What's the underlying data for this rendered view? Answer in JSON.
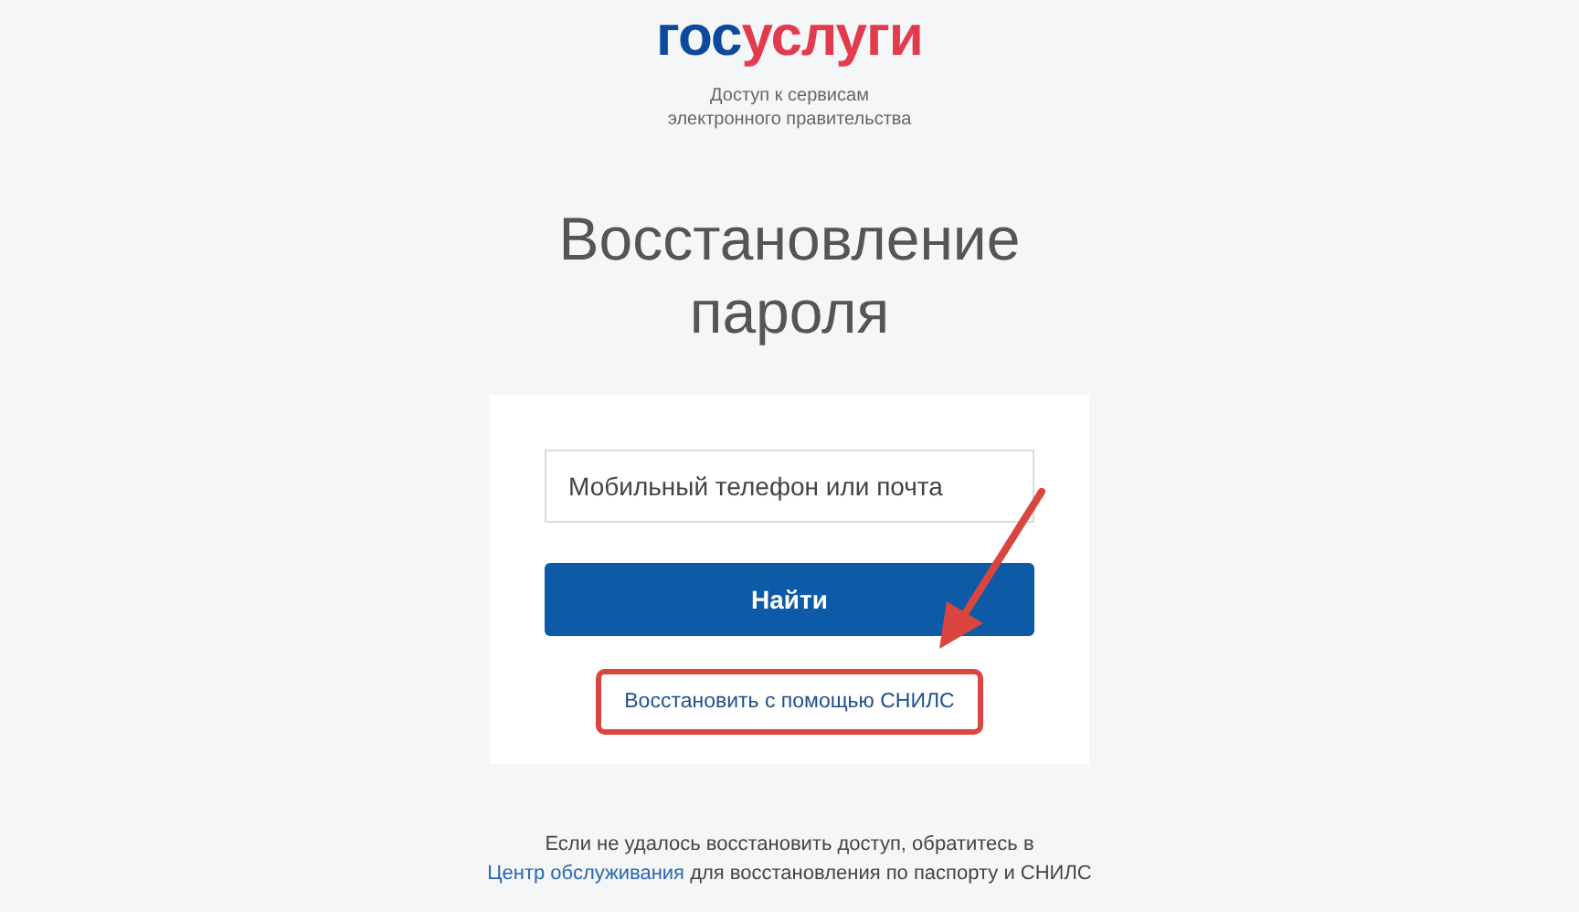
{
  "logo": {
    "parts": [
      {
        "text": "гос",
        "color": "#0d4a9b"
      },
      {
        "text": "услуги",
        "color": "#e23b4e"
      }
    ]
  },
  "tagline": [
    "Доступ к сервисам",
    "электронного правительства"
  ],
  "title": [
    "Восстановление",
    "пароля"
  ],
  "form": {
    "field": {
      "placeholder": "Мобильный телефон или почта"
    },
    "button": "Найти",
    "link": {
      "text": "Восстановить с помощью СНИЛС",
      "highlighted": true
    }
  },
  "footer": {
    "before": "Если не удалось восстановить доступ, обратитесь в",
    "link": "Центр обслуживания",
    "after": "для восстановления по паспорту и СНИЛС"
  }
}
